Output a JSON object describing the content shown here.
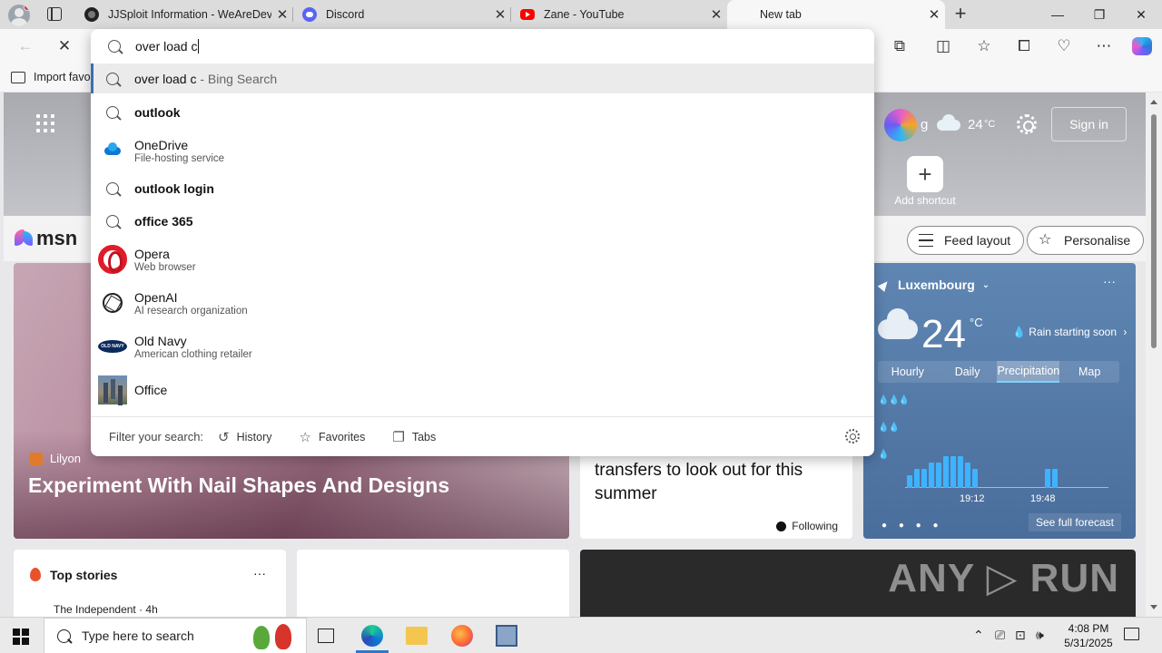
{
  "browser": {
    "tabs": [
      {
        "title": "JJSploit Information - WeAreDevs",
        "icon": "jjsploit-favicon"
      },
      {
        "title": "Discord",
        "icon": "discord-favicon"
      },
      {
        "title": "Zane - YouTube",
        "icon": "youtube-favicon"
      },
      {
        "title": "New tab",
        "icon": "none",
        "active": true
      }
    ],
    "bookmark_label": "Import favo"
  },
  "omnibox": {
    "value": "over load c",
    "suggestions": [
      {
        "type": "search",
        "text": "over load c",
        "suffix": " - Bing Search",
        "highlighted": true
      },
      {
        "type": "search",
        "text": "outlook"
      },
      {
        "type": "entity",
        "icon": "onedrive-icon",
        "text": "OneDrive",
        "sub": "File-hosting service"
      },
      {
        "type": "search",
        "text": "outlook login"
      },
      {
        "type": "search",
        "text": "office 365"
      },
      {
        "type": "entity",
        "icon": "opera-icon",
        "text": "Opera",
        "sub": "Web browser"
      },
      {
        "type": "entity",
        "icon": "openai-icon",
        "text": "OpenAI",
        "sub": "AI research organization"
      },
      {
        "type": "entity",
        "icon": "old-navy-icon",
        "text": "Old Navy",
        "sub": "American clothing retailer"
      },
      {
        "type": "entity",
        "icon": "office-icon",
        "text": "Office",
        "sub": ""
      }
    ],
    "filter_label": "Filter your search:",
    "filters": [
      {
        "label": "History",
        "icon": "history-icon"
      },
      {
        "label": "Favorites",
        "icon": "star-icon"
      },
      {
        "label": "Tabs",
        "icon": "tabs-icon"
      }
    ]
  },
  "ntp": {
    "user_partial": "g",
    "temp_small": "24",
    "temp_small_unit": "°C",
    "sign_in": "Sign in",
    "add_shortcut": "Add shortcut",
    "msn": "msn",
    "feed_layout": "Feed layout",
    "personalise": "Personalise",
    "hero_source": "Lilyon",
    "hero_headline": "Experiment With Nail Shapes And Designs",
    "news_text": "transfers to look out for this summer",
    "following": "Following",
    "top_stories": "Top stories",
    "top_stories_more": "···",
    "top_story_source": "The Independent · 4h",
    "watermark": "ANY ▷ RUN"
  },
  "weather": {
    "location": "Luxembourg",
    "temp": "24",
    "unit": "°C",
    "rain": "Rain starting soon",
    "tabs": [
      "Hourly",
      "Daily",
      "Precipitation",
      "Map"
    ],
    "active_tab": "Precipitation",
    "times": [
      "19:12",
      "19:48"
    ],
    "precip_values": [
      2,
      3,
      3,
      4,
      4,
      5,
      5,
      5,
      4,
      3,
      0,
      0,
      0,
      0,
      0,
      0,
      0,
      0,
      0,
      3,
      3
    ],
    "see_full": "See full forecast"
  },
  "taskbar": {
    "search_placeholder": "Type here to search",
    "time": "4:08 PM",
    "date": "5/31/2025"
  }
}
